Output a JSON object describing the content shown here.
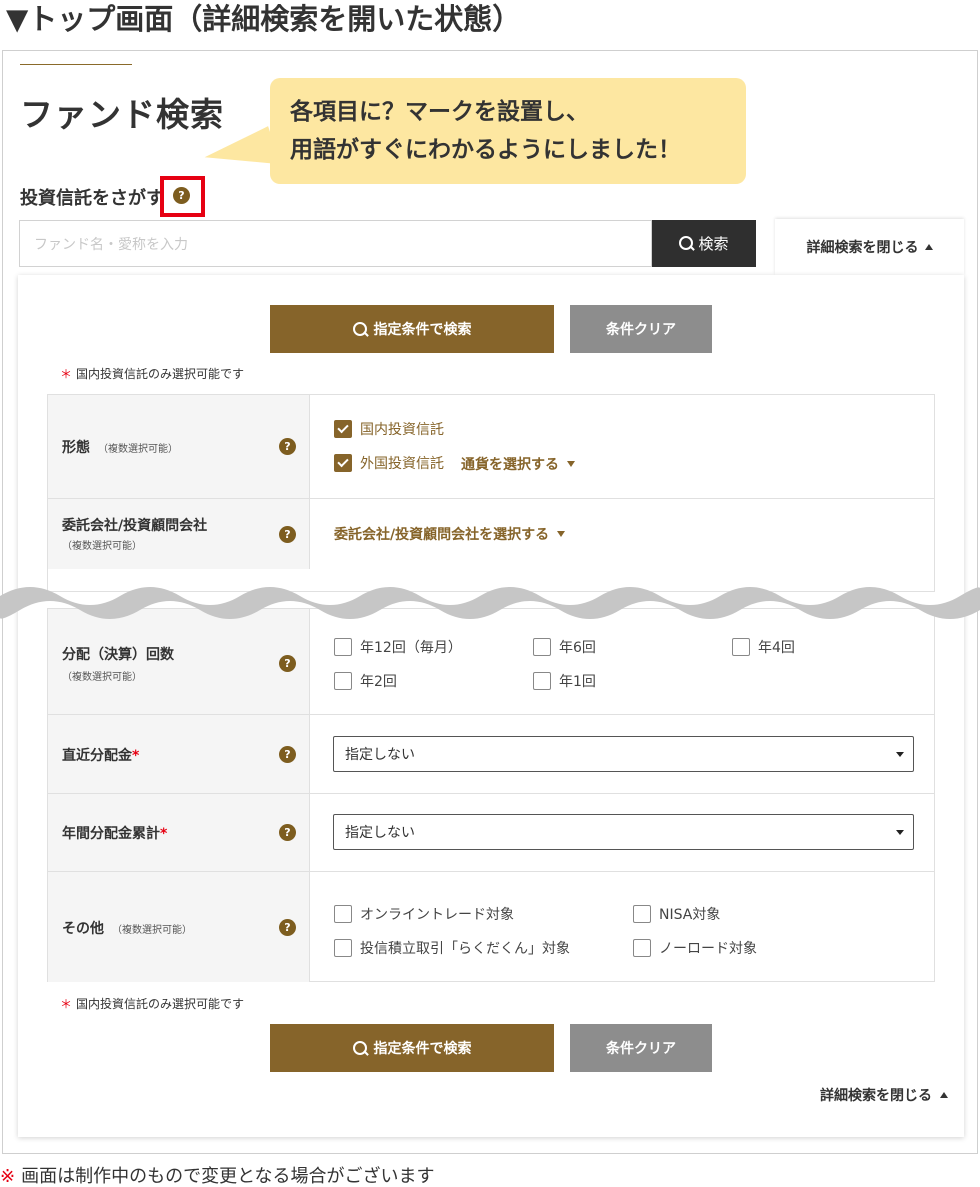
{
  "top_heading": "▼トップ画面（詳細検索を開いた状態）",
  "page_title": "ファンド検索",
  "callout": {
    "line1": "各項目に？マークを設置し、",
    "line2": "用語がすぐにわかるようにしました！"
  },
  "search": {
    "section_label": "投資信託をさがす",
    "placeholder": "ファンド名・愛称を入力",
    "button_label": "検索",
    "detail_close": "詳細検索を閉じる"
  },
  "help_icon_glyph": "?",
  "actions": {
    "search_label": "指定条件で検索",
    "clear_label": "条件クリア"
  },
  "note_mark": "＊",
  "note": "国内投資信託のみ選択可能です",
  "req_mark": "*",
  "rows": {
    "form": {
      "label": "形態",
      "sub": "（複数選択可能）",
      "options": [
        {
          "label": "国内投資信託",
          "checked": true
        },
        {
          "label": "外国投資信託",
          "checked": true
        }
      ],
      "currency_link": "通貨を選択する"
    },
    "company": {
      "label": "委託会社/投資顧問会社",
      "sub": "（複数選択可能）",
      "link": "委託会社/投資顧問会社を選択する"
    },
    "frequency": {
      "label": "分配（決算）回数",
      "sub": "（複数選択可能）",
      "options": [
        "年12回（毎月）",
        "年6回",
        "年4回",
        "年2回",
        "年1回"
      ]
    },
    "recent": {
      "label": "直近分配金",
      "value": "指定しない"
    },
    "annual": {
      "label": "年間分配金累計",
      "value": "指定しない"
    },
    "other": {
      "label": "その他",
      "sub": "（複数選択可能）",
      "options": [
        "オンライントレード対象",
        "NISA対象",
        "投信積立取引「らくだくん」対象",
        "ノーロード対象"
      ]
    }
  },
  "footnote": {
    "mark": "※",
    "text": "画面は制作中のもので変更となる場合がございます"
  },
  "colors": {
    "accent_gold": "#86642a",
    "callout_yellow": "#fde7a1",
    "highlight_red": "#e60012",
    "dark_button": "#2f2f2f",
    "clear_gray": "#8d8d8d"
  }
}
